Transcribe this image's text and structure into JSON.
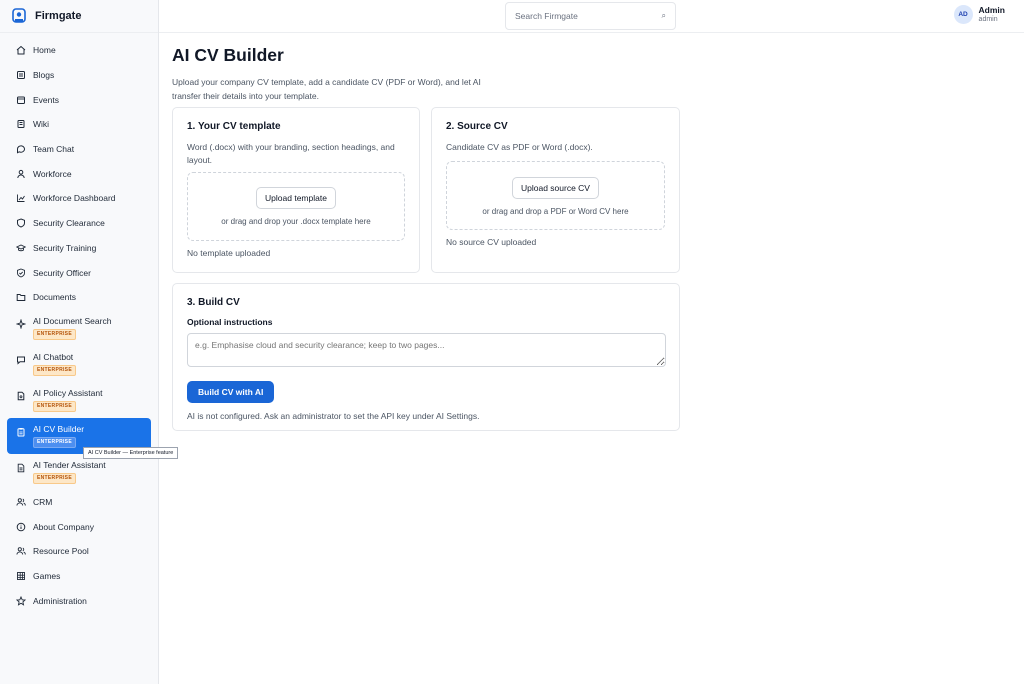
{
  "app": {
    "name": "Firmgate"
  },
  "search": {
    "placeholder": "Search Firmgate",
    "icon": "search-icon"
  },
  "user": {
    "initials": "AD",
    "name": "Admin",
    "role": "admin"
  },
  "sidebar": {
    "items": [
      {
        "label": "Home",
        "icon": "home-icon"
      },
      {
        "label": "Blogs",
        "icon": "blog-icon"
      },
      {
        "label": "Events",
        "icon": "calendar-icon"
      },
      {
        "label": "Wiki",
        "icon": "book-icon"
      },
      {
        "label": "Team Chat",
        "icon": "chat-icon"
      },
      {
        "label": "Workforce",
        "icon": "person-icon"
      },
      {
        "label": "Workforce Dashboard",
        "icon": "chart-icon"
      },
      {
        "label": "Security Clearance",
        "icon": "shield-icon"
      },
      {
        "label": "Security Training",
        "icon": "graduation-cap-icon"
      },
      {
        "label": "Security Officer",
        "icon": "shield-check-icon"
      },
      {
        "label": "Documents",
        "icon": "folder-icon"
      },
      {
        "label": "AI Document Search",
        "icon": "sparkle-icon",
        "badge": "ENTERPRISE"
      },
      {
        "label": "AI Chatbot",
        "icon": "message-icon",
        "badge": "ENTERPRISE"
      },
      {
        "label": "AI Policy Assistant",
        "icon": "file-icon",
        "badge": "ENTERPRISE"
      },
      {
        "label": "AI CV Builder",
        "icon": "clipboard-icon",
        "badge": "ENTERPRISE",
        "active": true
      },
      {
        "label": "AI Tender Assistant",
        "icon": "file-text-icon",
        "badge": "ENTERPRISE"
      },
      {
        "label": "CRM",
        "icon": "users-icon"
      },
      {
        "label": "About Company",
        "icon": "info-icon"
      },
      {
        "label": "Resource Pool",
        "icon": "users-icon"
      },
      {
        "label": "Games",
        "icon": "grid-icon"
      },
      {
        "label": "Administration",
        "icon": "star-icon"
      }
    ],
    "tooltip": "AI CV Builder — Enterprise feature"
  },
  "page": {
    "title": "AI CV Builder",
    "description": "Upload your company CV template, add a candidate CV (PDF or Word), and let AI transfer their details into your template."
  },
  "template_card": {
    "title": "1. Your CV template",
    "description": "Word (.docx) with your branding, section headings, and layout.",
    "button": "Upload template",
    "hint": "or drag and drop your .docx template here",
    "status": "No template uploaded"
  },
  "source_card": {
    "title": "2. Source CV",
    "description": "Candidate CV as PDF or Word (.docx).",
    "button": "Upload source CV",
    "hint": "or drag and drop a PDF or Word CV here",
    "status": "No source CV uploaded"
  },
  "build_card": {
    "title": "3. Build CV",
    "label": "Optional instructions",
    "placeholder": "e.g. Emphasise cloud and security clearance; keep to two pages...",
    "button": "Build CV with AI",
    "note": "AI is not configured. Ask an administrator to set the API key under AI Settings."
  },
  "colors": {
    "accent": "#1a73e8",
    "badge_bg": "#fde7c7",
    "badge_text": "#b45309"
  }
}
